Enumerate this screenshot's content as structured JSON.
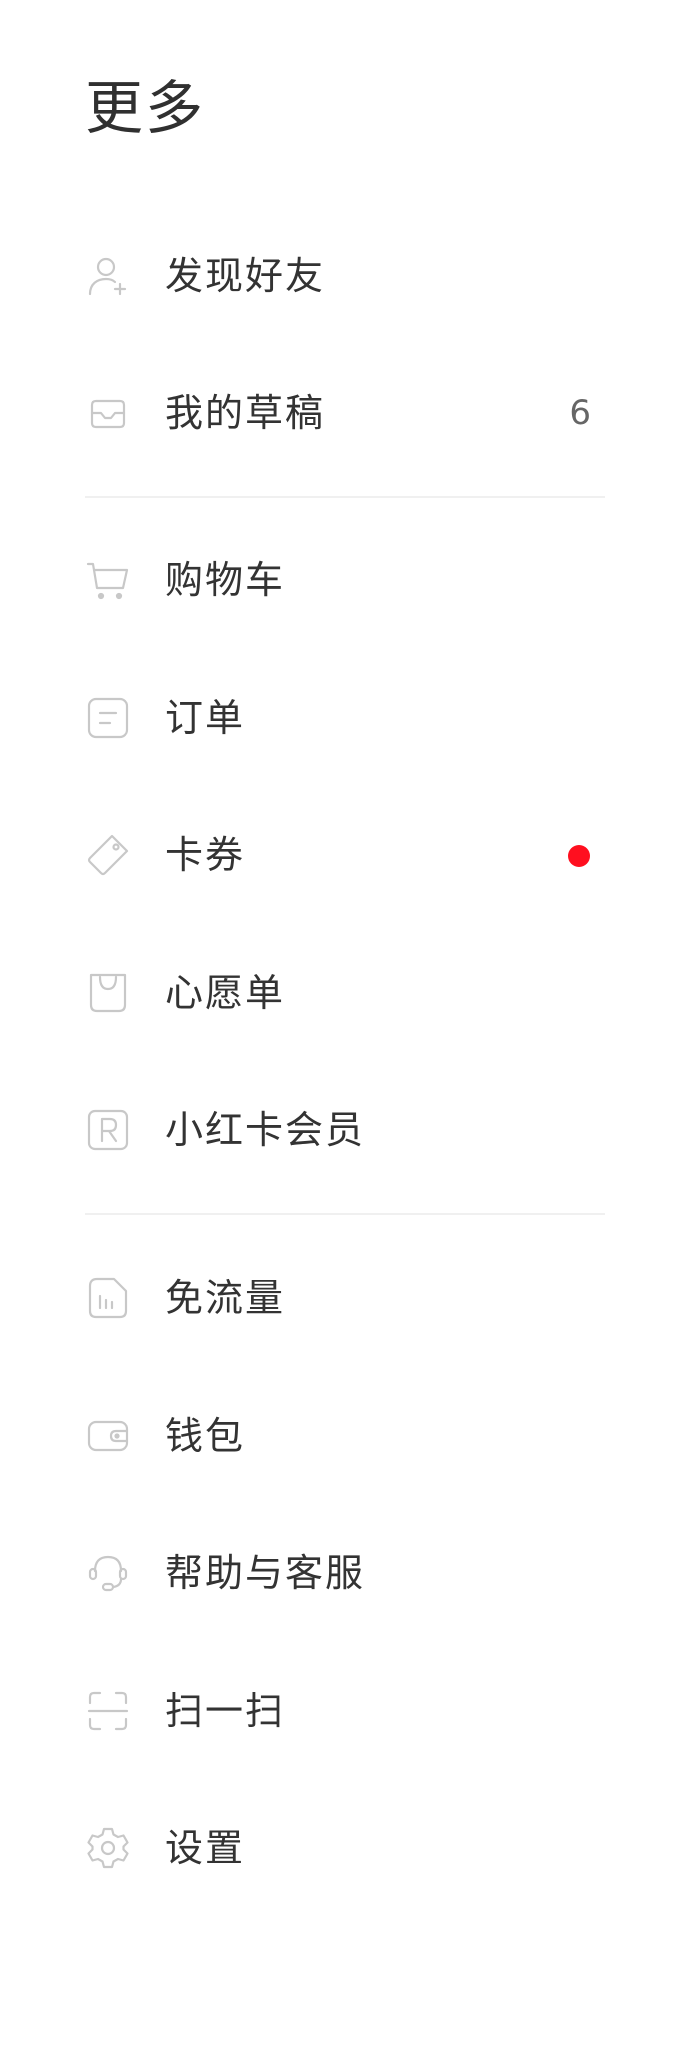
{
  "header": {
    "title": "更多"
  },
  "menu": {
    "items": [
      {
        "label": "发现好友",
        "icon": "add-friend-icon"
      },
      {
        "label": "我的草稿",
        "icon": "drafts-inbox-icon",
        "count": "6"
      },
      {
        "label": "购物车",
        "icon": "shopping-cart-icon"
      },
      {
        "label": "订单",
        "icon": "order-list-icon"
      },
      {
        "label": "卡券",
        "icon": "coupon-tag-icon",
        "badge": "red-dot"
      },
      {
        "label": "心愿单",
        "icon": "wishlist-bag-icon"
      },
      {
        "label": "小红卡会员",
        "icon": "membership-card-icon"
      },
      {
        "label": "免流量",
        "icon": "free-data-sim-icon"
      },
      {
        "label": "钱包",
        "icon": "wallet-icon"
      },
      {
        "label": "帮助与客服",
        "icon": "customer-service-headset-icon"
      },
      {
        "label": "扫一扫",
        "icon": "scan-icon"
      },
      {
        "label": "设置",
        "icon": "settings-gear-icon"
      }
    ]
  },
  "colors": {
    "icon_stroke": "#c8c8c8",
    "text": "#333333",
    "badge": "#ff0f1f",
    "divider": "#f0f0f0"
  }
}
